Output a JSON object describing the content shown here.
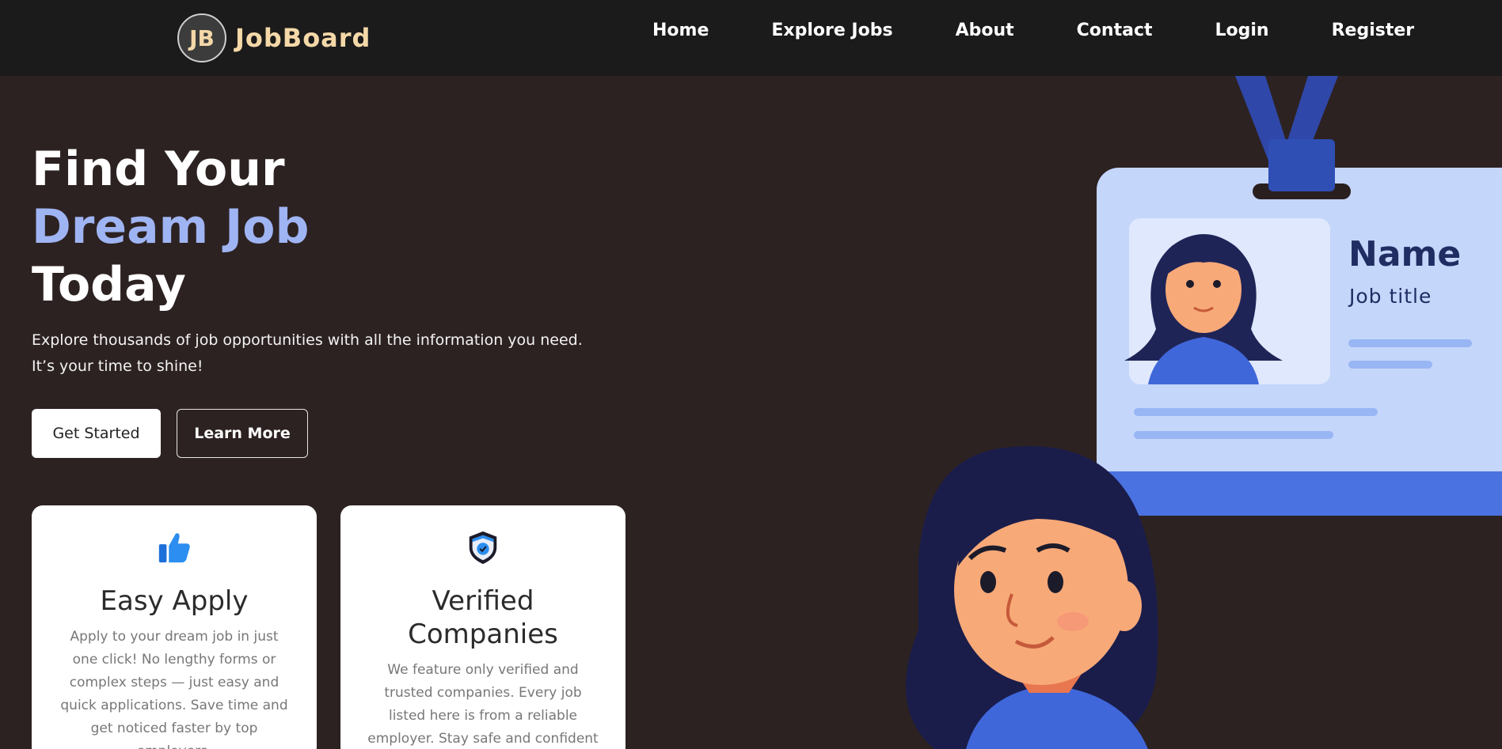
{
  "brand": {
    "logo_text": "JB",
    "name": "JobBoard"
  },
  "nav": {
    "items": [
      "Home",
      "Explore Jobs",
      "About",
      "Contact",
      "Login",
      "Register"
    ]
  },
  "hero": {
    "title_line1": "Find Your",
    "title_line2": "Dream Job",
    "title_line3": "Today",
    "subtitle_line1": "Explore thousands of job opportunities with all the information you need.",
    "subtitle_line2": "It’s your time to shine!",
    "primary_button": "Get Started",
    "secondary_button": "Learn More"
  },
  "features": [
    {
      "icon": "thumbs-up-icon",
      "title": "Easy Apply",
      "text": "Apply to your dream job in just one click! No lengthy forms or complex steps — just easy and quick applications. Save time and get noticed faster by top employers."
    },
    {
      "icon": "shield-check-icon",
      "title": "Verified Companies",
      "text": "We feature only verified and trusted companies. Every job listed here is from a reliable employer. Stay safe and confident while applying to"
    }
  ],
  "id_badge": {
    "name": "Name",
    "job_title": "Job title"
  },
  "colors": {
    "background": "#2d2222",
    "navbar": "#1b1b1b",
    "brand": "#f4d8a8",
    "accent": "#9fb4f2",
    "badge_blue": "#4a72e0"
  }
}
